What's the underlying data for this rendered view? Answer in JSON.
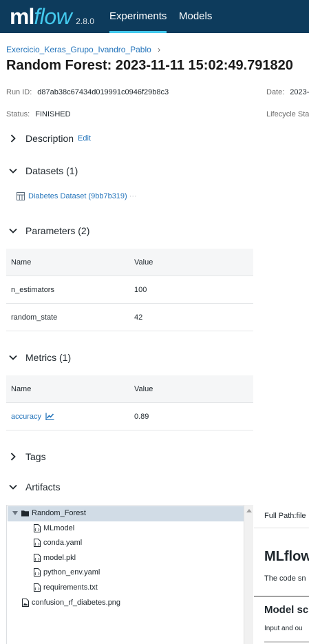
{
  "header": {
    "logo_ml": "ml",
    "logo_flow": "flow",
    "version": "2.8.0",
    "tabs": [
      {
        "label": "Experiments",
        "active": true
      },
      {
        "label": "Models",
        "active": false
      }
    ],
    "accent_color": "#43c9ed",
    "bar_color": "#0d3b5c"
  },
  "breadcrumb": {
    "experiment": "Exercicio_Keras_Grupo_Ivandro_Pablo",
    "separator": "›"
  },
  "title": "Random Forest: 2023-11-11 15:02:49.791820",
  "meta": {
    "run_id_label": "Run ID:",
    "run_id": "d87ab38c67434d019991c0946f29b8c3",
    "date_label": "Date:",
    "date": "2023-",
    "status_label": "Status:",
    "status": "FINISHED",
    "lifecycle_label": "Lifecycle Stag"
  },
  "sections": {
    "description": {
      "title": "Description",
      "edit": "Edit",
      "expanded": false
    },
    "datasets": {
      "title": "Datasets (1)",
      "expanded": true,
      "items": [
        "Diabetes Dataset (9bb7b319)"
      ],
      "more": "···"
    },
    "parameters": {
      "title": "Parameters (2)",
      "expanded": true,
      "columns": [
        "Name",
        "Value"
      ],
      "rows": [
        {
          "name": "n_estimators",
          "value": "100"
        },
        {
          "name": "random_state",
          "value": "42"
        }
      ]
    },
    "metrics": {
      "title": "Metrics (1)",
      "expanded": true,
      "columns": [
        "Name",
        "Value"
      ],
      "rows": [
        {
          "name": "accuracy",
          "value": "0.89",
          "icon": "chart-line-icon"
        }
      ]
    },
    "tags": {
      "title": "Tags",
      "expanded": false
    },
    "artifacts": {
      "title": "Artifacts",
      "expanded": true
    }
  },
  "artifacts": {
    "tree": {
      "folder": "Random_Forest",
      "children": [
        "MLmodel",
        "conda.yaml",
        "model.pkl",
        "python_env.yaml",
        "requirements.txt"
      ],
      "root_files": [
        "confusion_rf_diabetes.png"
      ]
    },
    "preview": {
      "full_path_label": "Full Path:file",
      "h1": "MLflow",
      "p1": "The code sn",
      "h2": "Model sc",
      "p2": "Input and ou"
    }
  }
}
